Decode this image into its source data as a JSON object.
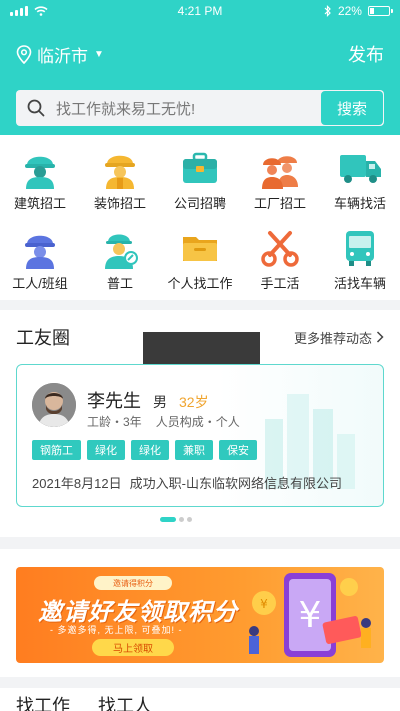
{
  "status_bar": {
    "time": "4:21 PM",
    "battery": "22%",
    "battery_level": 0.22
  },
  "nav": {
    "city": "临沂市",
    "publish": "发布"
  },
  "search": {
    "placeholder": "找工作就来易工无忧!",
    "button": "搜索"
  },
  "categories": [
    {
      "label": "建筑招工",
      "icon": "construction-worker-icon"
    },
    {
      "label": "装饰招工",
      "icon": "decorator-worker-icon"
    },
    {
      "label": "公司招聘",
      "icon": "briefcase-icon"
    },
    {
      "label": "工厂招工",
      "icon": "factory-workers-icon"
    },
    {
      "label": "车辆找活",
      "icon": "truck-icon"
    },
    {
      "label": "工人/班组",
      "icon": "team-worker-icon"
    },
    {
      "label": "普工",
      "icon": "general-worker-icon"
    },
    {
      "label": "个人找工作",
      "icon": "folder-icon"
    },
    {
      "label": "手工活",
      "icon": "scissors-icon"
    },
    {
      "label": "活找车辆",
      "icon": "bus-icon"
    }
  ],
  "circle": {
    "title": "工友圈",
    "more": "更多推荐动态",
    "card": {
      "name": "李先生",
      "gender": "男",
      "age": "32岁",
      "experience": "工龄・3年",
      "composition": "人员构成・个人",
      "tags": [
        "钢筋工",
        "绿化",
        "绿化",
        "兼职",
        "保安"
      ],
      "date": "2021年8月12日",
      "event": "成功入职-山东临软网络信息有限公司"
    }
  },
  "banner": {
    "pill": "邀请得积分",
    "title": "邀请好友领取积分",
    "subtitle": "- 多邀多得, 无上限, 可叠加! -",
    "cta": "马上领取"
  },
  "bottom_tabs": [
    "找工作",
    "找工人"
  ]
}
